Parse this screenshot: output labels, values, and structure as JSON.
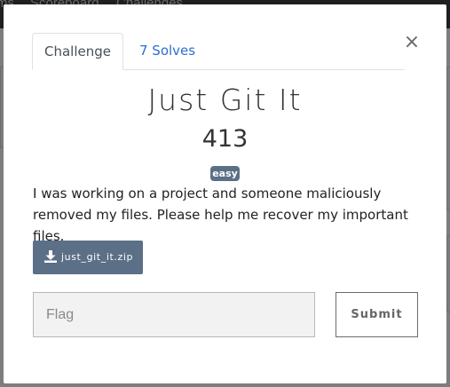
{
  "background": {
    "nav_items": [
      "ms",
      "Scoreboard",
      "Challenges"
    ]
  },
  "modal": {
    "tabs": [
      {
        "label": "Challenge",
        "active": true
      },
      {
        "label": "7 Solves",
        "active": false
      }
    ],
    "close_label": "×",
    "title": "Just Git It",
    "points": "413",
    "difficulty": "easy",
    "description": "I was working on a project and someone maliciously removed my files. Please help me recover my important files.",
    "file": {
      "name": "just_git_it.zip",
      "icon": "download-icon"
    },
    "flag_input": {
      "placeholder": "Flag",
      "value": ""
    },
    "submit_label": "Submit"
  },
  "colors": {
    "badge_bg": "#5b6f86",
    "file_button_bg": "#5b6f86",
    "tab_link": "#2b6fd0",
    "overlay": "#7d7d7d"
  }
}
